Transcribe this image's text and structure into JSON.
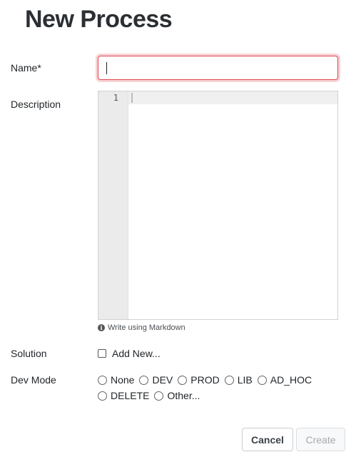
{
  "page_title": "New Process",
  "form": {
    "name_label": "Name*",
    "name_value": "",
    "description_label": "Description",
    "editor_line_number": "1",
    "markdown_hint": "Write using Markdown",
    "solution_label": "Solution",
    "add_new_label": "Add New...",
    "dev_mode_label": "Dev Mode",
    "dev_mode_options": [
      "None",
      "DEV",
      "PROD",
      "LIB",
      "AD_HOC",
      "DELETE",
      "Other..."
    ]
  },
  "buttons": {
    "cancel": "Cancel",
    "create": "Create"
  },
  "colors": {
    "invalid_border": "#e0454f",
    "title": "#2b2f33"
  }
}
